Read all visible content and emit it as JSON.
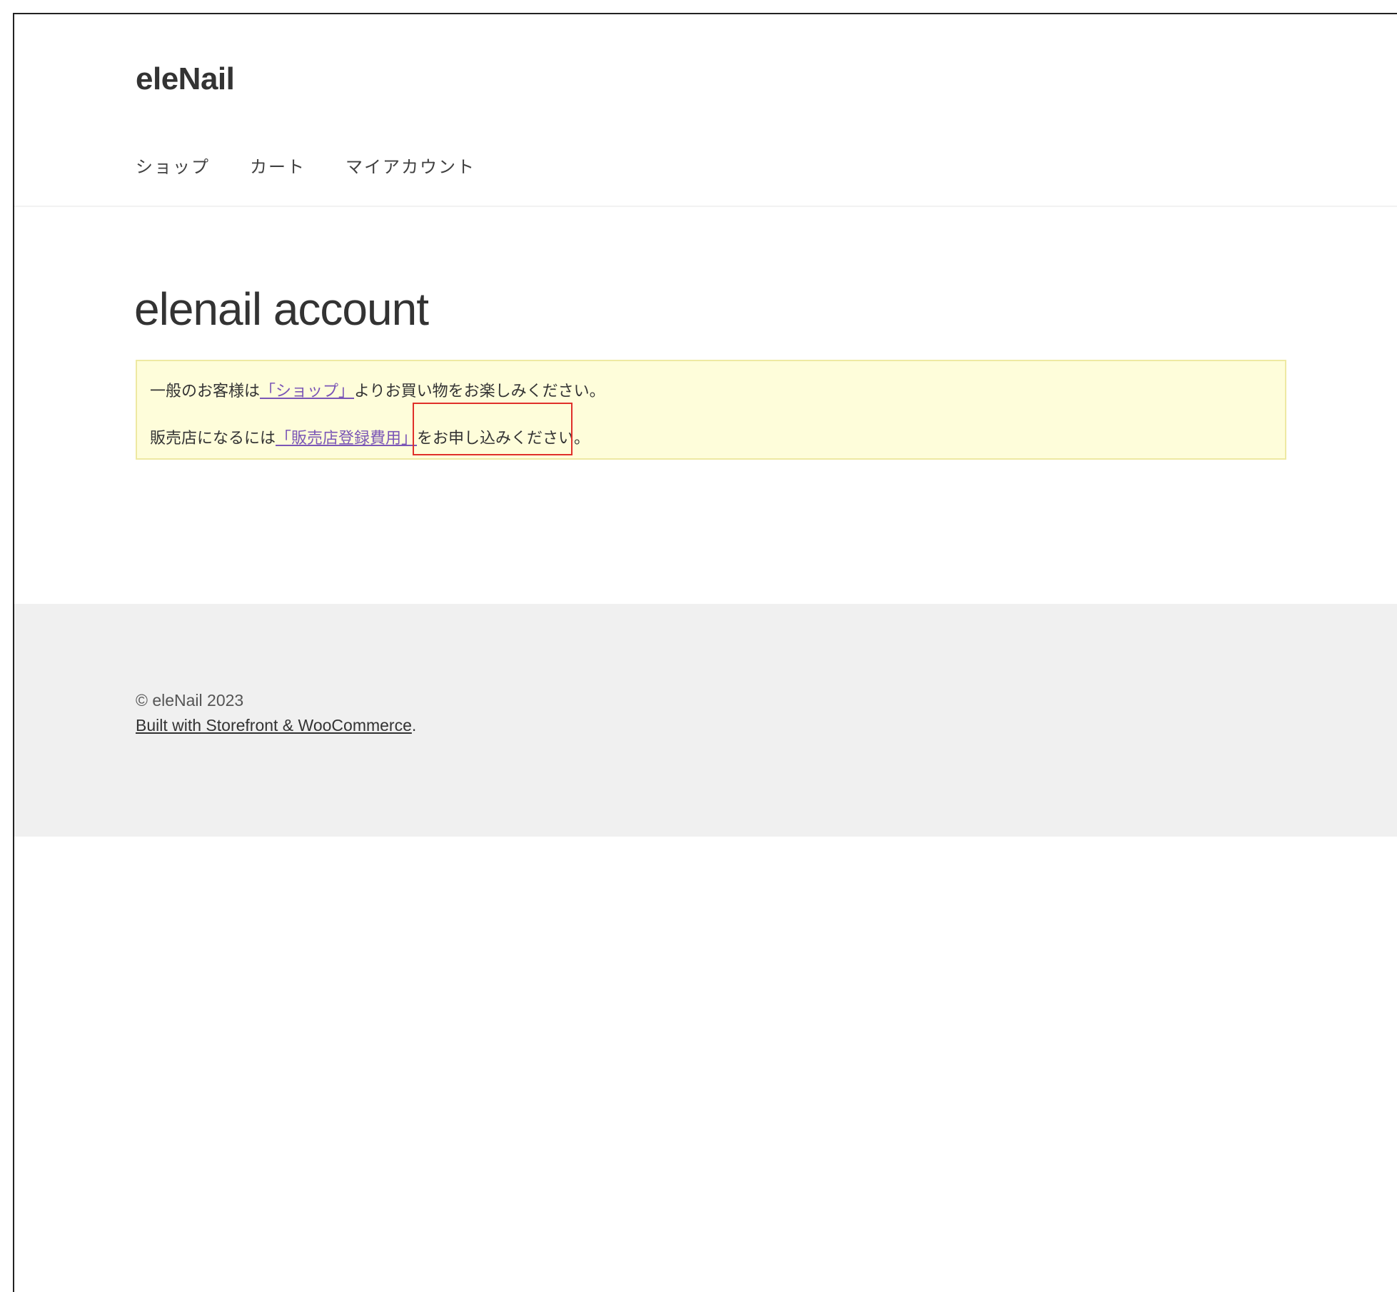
{
  "header": {
    "site_title": "eleNail",
    "nav": [
      {
        "label": "ショップ"
      },
      {
        "label": "カート"
      },
      {
        "label": "マイアカウント"
      }
    ]
  },
  "main": {
    "page_title": "elenail account",
    "notice": {
      "line1_prefix": "一般のお客様は",
      "line1_link": "「ショップ」",
      "line1_suffix": "よりお買い物をお楽しみください。",
      "line2_prefix": "販売店になるには",
      "line2_link": "「販売店登録費用」",
      "line2_suffix": "をお申し込みください。"
    }
  },
  "footer": {
    "copyright": "© eleNail 2023",
    "credit_link": "Built with Storefront & WooCommerce",
    "credit_suffix": "."
  },
  "colors": {
    "notice_background": "#fefdda",
    "notice_border": "#eee9a2",
    "link": "#7b56b6",
    "highlight": "#e0302a",
    "footer_background": "#f0f0f0"
  }
}
